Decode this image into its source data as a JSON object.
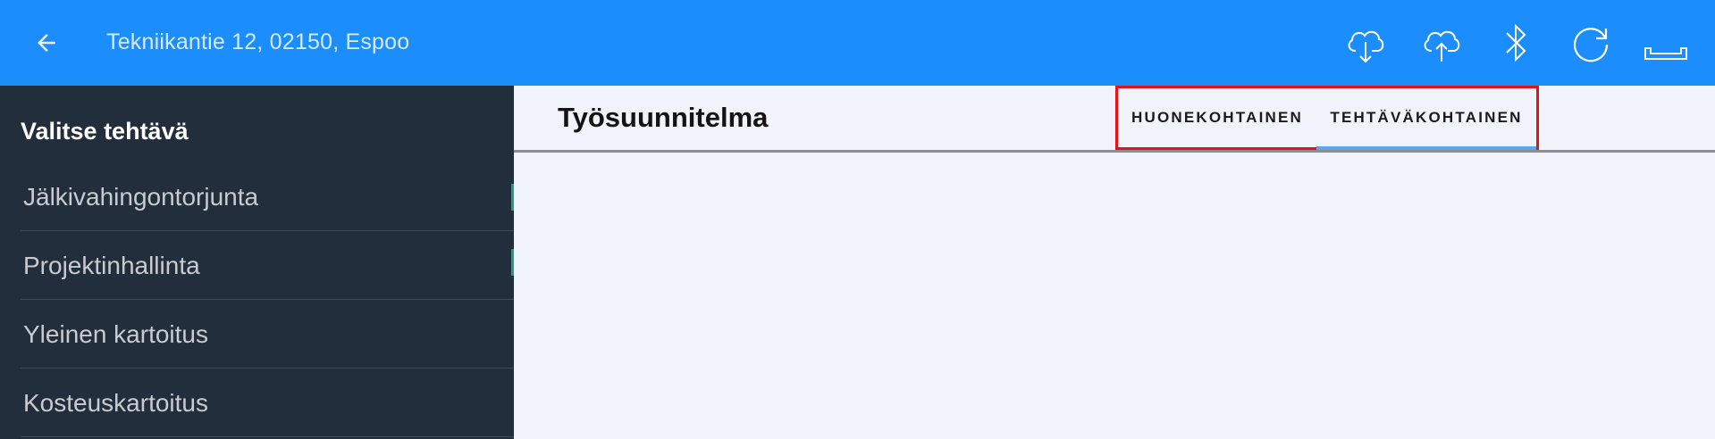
{
  "topbar": {
    "title": "Tekniikantie 12, 02150, Espoo",
    "icons": [
      "back-arrow-icon",
      "cloud-download-icon",
      "cloud-upload-icon",
      "bluetooth-icon",
      "refresh-icon",
      "measure-tool-icon"
    ],
    "color": "#1b8dfc"
  },
  "sidebar": {
    "heading": "Valitse tehtävä",
    "items": [
      {
        "label": "Jälkivahingontorjunta"
      },
      {
        "label": "Projektinhallinta"
      },
      {
        "label": "Yleinen kartoitus"
      },
      {
        "label": "Kosteuskartoitus"
      }
    ],
    "color": "#222e3b"
  },
  "main": {
    "title": "Työsuunnitelma",
    "tabs": [
      {
        "label": "HUONEKOHTAINEN",
        "active": false
      },
      {
        "label": "TEHTÄVÄKOHTAINEN",
        "active": true
      }
    ],
    "highlight_color": "#e3131b"
  }
}
